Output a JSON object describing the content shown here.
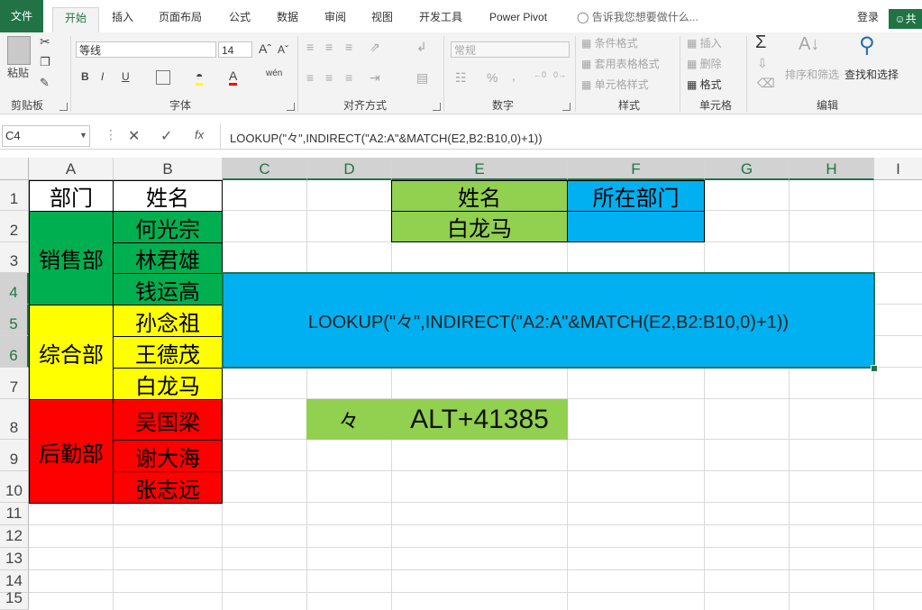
{
  "ribbon_tabs": {
    "file": "文件",
    "home": "开始",
    "insert": "插入",
    "page_layout": "页面布局",
    "formulas": "公式",
    "data": "数据",
    "review": "审阅",
    "view": "视图",
    "developer": "开发工具",
    "power_pivot": "Power Pivot",
    "tell_me": "告诉我您想要做什么...",
    "login": "登录",
    "share": "共"
  },
  "ribbon": {
    "clipboard": {
      "paste": "粘贴",
      "label": "剪贴板"
    },
    "font": {
      "name": "等线",
      "size": "14",
      "bold": "B",
      "italic": "I",
      "underline": "U",
      "wen": "wén",
      "label": "字体"
    },
    "alignment": {
      "label": "对齐方式"
    },
    "number": {
      "format": "常规",
      "percent": "%",
      "comma": ",",
      "label": "数字"
    },
    "styles": {
      "conditional": "条件格式",
      "table": "套用表格格式",
      "cell_styles": "单元格样式",
      "label": "样式"
    },
    "cells": {
      "insert": "插入",
      "delete": "删除",
      "format": "格式",
      "label": "单元格"
    },
    "editing": {
      "sort": "排序和筛选",
      "find": "查找和选择",
      "label": "编辑"
    }
  },
  "formula_bar": {
    "name_box": "C4",
    "formula": "LOOKUP(\"々\",INDIRECT(\"A2:A\"&MATCH(E2,B2:B10,0)+1))",
    "fx": "fx"
  },
  "columns": [
    "A",
    "B",
    "C",
    "D",
    "E",
    "F",
    "G",
    "H",
    "I"
  ],
  "rows": [
    "1",
    "2",
    "3",
    "4",
    "5",
    "6",
    "7",
    "8",
    "9",
    "10",
    "11",
    "12",
    "13",
    "14",
    "15"
  ],
  "cells": {
    "A1": "部门",
    "B1": "姓名",
    "sales": "销售部",
    "general": "综合部",
    "logistics": "后勤部",
    "names": [
      "何光宗",
      "林君雄",
      "钱运高",
      "孙念祖",
      "王德茂",
      "白龙马",
      "吴国梁",
      "谢大海",
      "张志远"
    ],
    "E1": "姓名",
    "F1": "所在部门",
    "E2": "白龙马",
    "merged_formula": "LOOKUP(\"々\",INDIRECT(\"A2:A\"&MATCH(E2,B2:B10,0)+1))",
    "D8": "々",
    "E8": "ALT+41385"
  },
  "colors": {
    "excel_green": "#217346",
    "cell_green": "#00b050",
    "cell_yellow": "#ffff00",
    "cell_red": "#ff0000",
    "cell_lightgreen": "#92d050",
    "cell_blue": "#00b0f0"
  },
  "icons": [
    "cut-icon",
    "copy-icon",
    "format-painter-icon",
    "fill-color-icon",
    "font-color-icon",
    "sum-icon",
    "sort-icon",
    "find-icon",
    "lightbulb-icon",
    "person-icon"
  ]
}
